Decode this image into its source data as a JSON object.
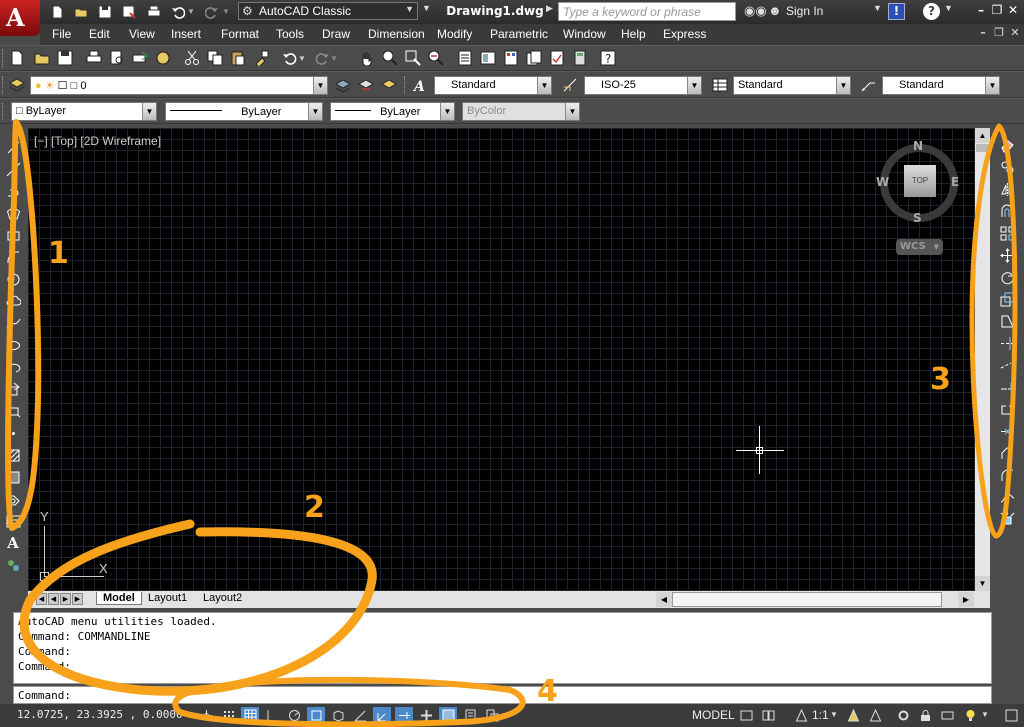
{
  "app": {
    "logo_letter": "A"
  },
  "titlebar": {
    "workspace": "AutoCAD Classic",
    "document_title": "Drawing1.dwg",
    "search_placeholder": "Type a keyword or phrase",
    "sign_in": "Sign In",
    "info_label": "!",
    "help_label": "?"
  },
  "menus": [
    "File",
    "Edit",
    "View",
    "Insert",
    "Format",
    "Tools",
    "Draw",
    "Dimension",
    "Modify",
    "Parametric",
    "Window",
    "Help",
    "Express"
  ],
  "layers": {
    "current_layer": "0"
  },
  "styles": {
    "text_style": "Standard",
    "dim_style": "ISO-25",
    "table_style": "Standard",
    "mleader_style": "Standard"
  },
  "properties": {
    "color": "ByLayer",
    "linetype": "ByLayer",
    "lineweight": "ByLayer",
    "plot_style": "ByColor"
  },
  "viewport": {
    "label": "[−] [Top] [2D Wireframe]",
    "viewcube": {
      "north": "N",
      "south": "S",
      "east": "E",
      "west": "W",
      "face": "TOP"
    },
    "wcs_label": "WCS",
    "ucs": {
      "x": "X",
      "y": "Y"
    }
  },
  "tabs": [
    "Model",
    "Layout1",
    "Layout2"
  ],
  "command_history": [
    "AutoCAD menu utilities loaded.",
    "Command: COMMANDLINE",
    "Command:",
    "Command:"
  ],
  "command_prompt": "Command:",
  "statusbar": {
    "coordinates": "12.0725, 23.3925 , 0.0000",
    "space": "MODEL",
    "annotation_scale": "1:1"
  },
  "annotations": [
    "1",
    "2",
    "3",
    "4"
  ],
  "colors": {
    "annotation": "#f7a21a",
    "canvas": "#000000",
    "status_on": "#4b89c8"
  },
  "icons": {
    "quick_access": [
      "new-icon",
      "open-icon",
      "save-icon",
      "save-as-icon",
      "print-icon",
      "undo-icon",
      "redo-icon"
    ],
    "left_draw_toolbar": [
      "line-icon",
      "construction-line-icon",
      "polyline-icon",
      "polygon-icon",
      "rectangle-icon",
      "arc-icon",
      "circle-icon",
      "revision-cloud-icon",
      "spline-icon",
      "ellipse-icon",
      "ellipse-arc-icon",
      "insert-block-icon",
      "make-block-icon",
      "point-icon",
      "hatch-icon",
      "gradient-icon",
      "region-icon",
      "table-icon",
      "multiline-text-icon",
      "add-selected-icon"
    ],
    "right_modify_toolbar": [
      "erase-icon",
      "copy-icon",
      "mirror-icon",
      "offset-icon",
      "array-icon",
      "move-icon",
      "rotate-icon",
      "scale-icon",
      "stretch-icon",
      "trim-icon",
      "extend-icon",
      "break-at-point-icon",
      "break-icon",
      "join-icon",
      "chamfer-icon",
      "fillet-icon",
      "blend-curves-icon",
      "explode-icon"
    ]
  }
}
